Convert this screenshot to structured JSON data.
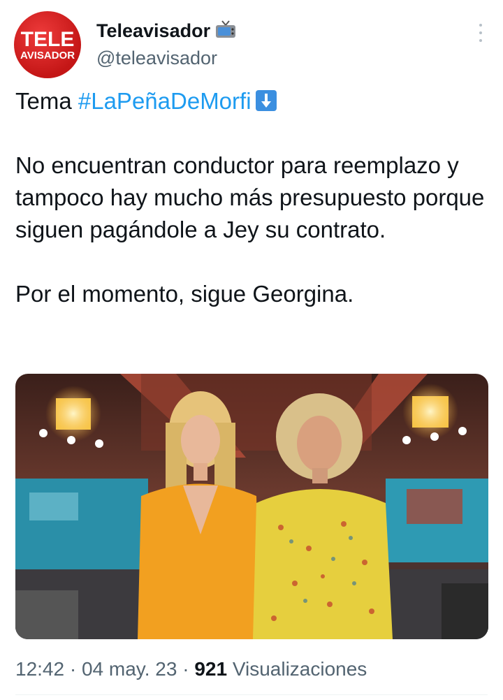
{
  "tweet": {
    "avatar": {
      "line1": "TELE",
      "line2": "AVISADOR"
    },
    "author_name": "Teleavisador",
    "author_emoji": "tv-icon",
    "handle": "@teleavisador",
    "line1_prefix": "Tema ",
    "hashtag": "#LaPeñaDeMorfi",
    "line1_emoji": "down-arrow-icon",
    "paragraph2": "No encuentran conductor para reemplazo y tampoco hay mucho más presupuesto porque siguen pagándole a Jey su contrato.",
    "paragraph3": "Por el momento, sigue Georgina.",
    "image": "photo-two-women-tv-studio",
    "time": "12:42",
    "sep1": "·",
    "date": "04 may. 23",
    "sep2": "·",
    "views_count": "921",
    "views_label": "Visualizaciones"
  },
  "colors": {
    "hashtag": "#1d9bf0",
    "secondary_text": "#536471",
    "primary_text": "#0f1419",
    "avatar_bg": "#d11f1f"
  }
}
